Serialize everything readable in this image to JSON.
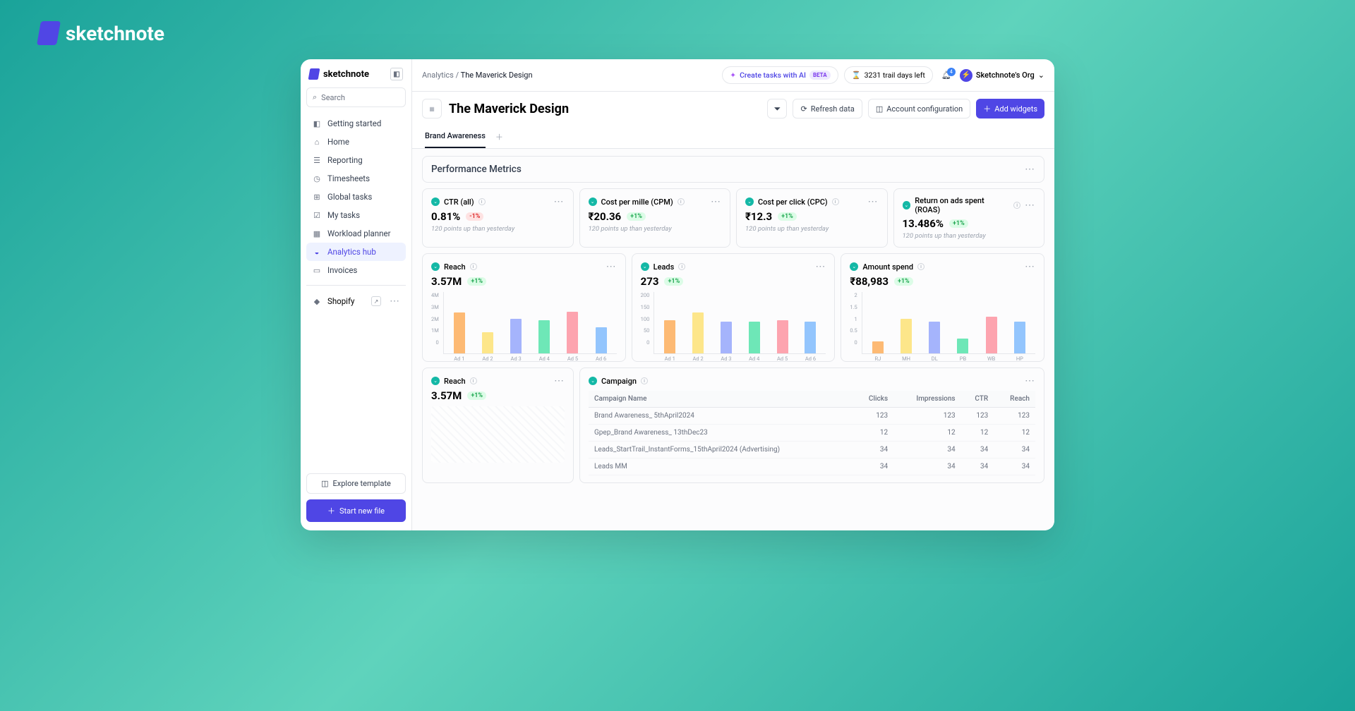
{
  "outer_logo": "sketchnote",
  "sidebar": {
    "logo": "sketchnote",
    "search_placeholder": "Search",
    "nav": [
      {
        "icon": "◧",
        "label": "Getting started"
      },
      {
        "icon": "⌂",
        "label": "Home"
      },
      {
        "icon": "☰",
        "label": "Reporting"
      },
      {
        "icon": "◷",
        "label": "Timesheets"
      },
      {
        "icon": "⊞",
        "label": "Global tasks"
      },
      {
        "icon": "☑",
        "label": "My tasks"
      },
      {
        "icon": "▦",
        "label": "Workload planner"
      },
      {
        "icon": "◒",
        "label": "Analytics hub",
        "active": true
      },
      {
        "icon": "▭",
        "label": "Invoices"
      }
    ],
    "shopify": "Shopify",
    "explore": "Explore template",
    "start": "Start new file"
  },
  "topbar": {
    "crumb1": "Analytics",
    "crumb2": "The Maverick Design",
    "ai_label": "Create tasks with AI",
    "beta": "BETA",
    "trial": "3231 trail days left",
    "bell_count": "4",
    "org": "Sketchnote's Org"
  },
  "header": {
    "title": "The Maverick Design",
    "refresh": "Refresh data",
    "config": "Account configuration",
    "add": "Add widgets"
  },
  "tabs": {
    "t1": "Brand Awareness"
  },
  "section": {
    "title": "Performance Metrics"
  },
  "metrics": [
    {
      "title": "CTR (all)",
      "value": "0.81%",
      "delta": "-1%",
      "dir": "down",
      "sub": "120 points up than yesterday"
    },
    {
      "title": "Cost per mille (CPM)",
      "value": "₹20.36",
      "delta": "+1%",
      "dir": "up",
      "sub": "120 points up than yesterday"
    },
    {
      "title": "Cost per click (CPC)",
      "value": "₹12.3",
      "delta": "+1%",
      "dir": "up",
      "sub": "120 points up than yesterday"
    },
    {
      "title": "Return on ads spent (ROAS)",
      "value": "13.486%",
      "delta": "+1%",
      "dir": "up",
      "sub": "120 points up than yesterday"
    }
  ],
  "charts": [
    {
      "title": "Reach",
      "value": "3.57M",
      "delta": "+1%"
    },
    {
      "title": "Leads",
      "value": "273",
      "delta": "+1%"
    },
    {
      "title": "Amount spend",
      "value": "₹88,983",
      "delta": "+1%"
    }
  ],
  "reach2": {
    "title": "Reach",
    "value": "3.57M",
    "delta": "+1%"
  },
  "campaign": {
    "title": "Campaign",
    "headers": [
      "Campaign Name",
      "Clicks",
      "Impressions",
      "CTR",
      "Reach"
    ],
    "rows": [
      {
        "name": "Brand Awareness_ 5thApril2024",
        "c": "123",
        "i": "123",
        "ctr": "123",
        "r": "123"
      },
      {
        "name": "Gpep_Brand Awareness_ 13thDec23",
        "c": "12",
        "i": "12",
        "ctr": "12",
        "r": "12"
      },
      {
        "name": "Leads_StartTrail_InstantForms_15thApril2024 (Advertising)",
        "c": "34",
        "i": "34",
        "ctr": "34",
        "r": "34"
      },
      {
        "name": "Leads MM",
        "c": "34",
        "i": "34",
        "ctr": "34",
        "r": "34"
      }
    ]
  },
  "chart_data": [
    {
      "type": "bar",
      "title": "Reach",
      "ylabel": "",
      "ylim": [
        0,
        4000000
      ],
      "yticks": [
        "4M",
        "3M",
        "2M",
        "1M",
        "0"
      ],
      "categories": [
        "Ad 1",
        "Ad 2",
        "Ad 3",
        "Ad 4",
        "Ad 5",
        "Ad 6"
      ],
      "values": [
        3300000,
        1700000,
        2800000,
        2700000,
        3400000,
        2100000
      ],
      "colors": [
        "#fdba74",
        "#fde68a",
        "#a5b4fc",
        "#6ee7b7",
        "#fda4af",
        "#93c5fd"
      ]
    },
    {
      "type": "bar",
      "title": "Leads",
      "ylabel": "",
      "ylim": [
        0,
        200
      ],
      "yticks": [
        "200",
        "150",
        "100",
        "50",
        "0"
      ],
      "categories": [
        "Ad 1",
        "Ad 2",
        "Ad 3",
        "Ad 4",
        "Ad 5",
        "Ad 6"
      ],
      "values": [
        135,
        165,
        130,
        130,
        135,
        130
      ],
      "colors": [
        "#fdba74",
        "#fde68a",
        "#a5b4fc",
        "#6ee7b7",
        "#fda4af",
        "#93c5fd"
      ]
    },
    {
      "type": "bar",
      "title": "Amount spend",
      "ylabel": "",
      "ylim": [
        0,
        2
      ],
      "yticks": [
        "2",
        "1.5",
        "1",
        "0.5",
        "0"
      ],
      "categories": [
        "RJ",
        "MH",
        "DL",
        "PB",
        "WB",
        "HP"
      ],
      "values": [
        0.5,
        1.4,
        1.3,
        0.6,
        1.5,
        1.3
      ],
      "colors": [
        "#fdba74",
        "#fde68a",
        "#a5b4fc",
        "#6ee7b7",
        "#fda4af",
        "#93c5fd"
      ]
    }
  ]
}
